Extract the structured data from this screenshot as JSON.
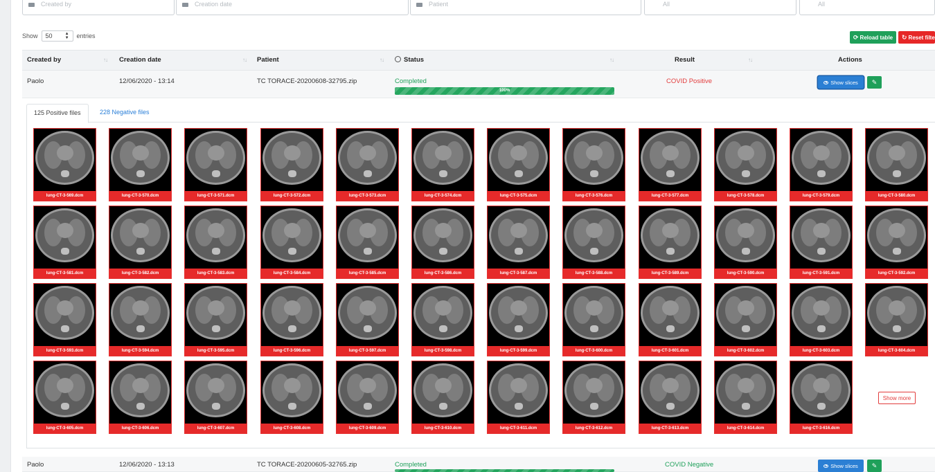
{
  "filters": [
    {
      "placeholder": "Created by"
    },
    {
      "placeholder": "Creation date"
    },
    {
      "placeholder": "Patient"
    },
    {
      "placeholder": "All"
    },
    {
      "placeholder": "All"
    }
  ],
  "show_entries": {
    "show": "Show",
    "value": "50",
    "entries": "entries"
  },
  "buttons": {
    "reload": "Reload table",
    "reset": "Reset filters"
  },
  "table": {
    "headers": {
      "created_by": "Created by",
      "creation_date": "Creation date",
      "patient": "Patient",
      "status": "Status",
      "result": "Result",
      "actions": "Actions"
    },
    "rows": [
      {
        "created_by": "Paolo",
        "date": "12/06/2020 - 13:14",
        "patient": "TC TORACE-20200608-32795.zip",
        "status": "Completed",
        "progress_pct": 100,
        "progress_label": "100%",
        "result": "COVID Positive",
        "show_slices": "Show slices"
      },
      {
        "created_by": "Paolo",
        "date": "12/06/2020 - 13:13",
        "patient": "TC TORACE-20200605-32765.zip",
        "status": "Completed",
        "progress_pct": 100,
        "progress_label": "100%",
        "result": "COVID Negative",
        "show_slices": "Show slices"
      }
    ]
  },
  "tabs": {
    "positive": "125 Positive files",
    "negative": "228 Negative files"
  },
  "slices": [
    "lung-CT-3-569.dcm",
    "lung-CT-3-570.dcm",
    "lung-CT-3-571.dcm",
    "lung-CT-3-572.dcm",
    "lung-CT-3-573.dcm",
    "lung-CT-3-574.dcm",
    "lung-CT-3-575.dcm",
    "lung-CT-3-576.dcm",
    "lung-CT-3-577.dcm",
    "lung-CT-3-578.dcm",
    "lung-CT-3-579.dcm",
    "lung-CT-3-580.dcm",
    "lung-CT-3-581.dcm",
    "lung-CT-3-582.dcm",
    "lung-CT-3-583.dcm",
    "lung-CT-3-584.dcm",
    "lung-CT-3-585.dcm",
    "lung-CT-3-586.dcm",
    "lung-CT-3-587.dcm",
    "lung-CT-3-588.dcm",
    "lung-CT-3-589.dcm",
    "lung-CT-3-590.dcm",
    "lung-CT-3-591.dcm",
    "lung-CT-3-592.dcm",
    "lung-CT-3-593.dcm",
    "lung-CT-3-594.dcm",
    "lung-CT-3-595.dcm",
    "lung-CT-3-596.dcm",
    "lung-CT-3-597.dcm",
    "lung-CT-3-598.dcm",
    "lung-CT-3-599.dcm",
    "lung-CT-3-600.dcm",
    "lung-CT-3-601.dcm",
    "lung-CT-3-602.dcm",
    "lung-CT-3-603.dcm",
    "lung-CT-3-604.dcm",
    "lung-CT-3-605.dcm",
    "lung-CT-3-606.dcm",
    "lung-CT-3-607.dcm",
    "lung-CT-3-608.dcm",
    "lung-CT-3-609.dcm",
    "lung-CT-3-610.dcm",
    "lung-CT-3-611.dcm",
    "lung-CT-3-612.dcm",
    "lung-CT-3-613.dcm",
    "lung-CT-3-614.dcm",
    "lung-CT-3-616.dcm"
  ],
  "show_more": "Show more",
  "colors": {
    "success": "#1fa05a",
    "danger": "#e62a2a",
    "primary": "#2b7fd4",
    "link": "#2a7fd8"
  },
  "icons": {
    "filter": "calendar-icon",
    "reload": "refresh-icon",
    "reset": "reset-icon",
    "view": "eye-icon",
    "edit": "edit-icon",
    "sort": "sort-icon",
    "status": "circle-icon"
  }
}
